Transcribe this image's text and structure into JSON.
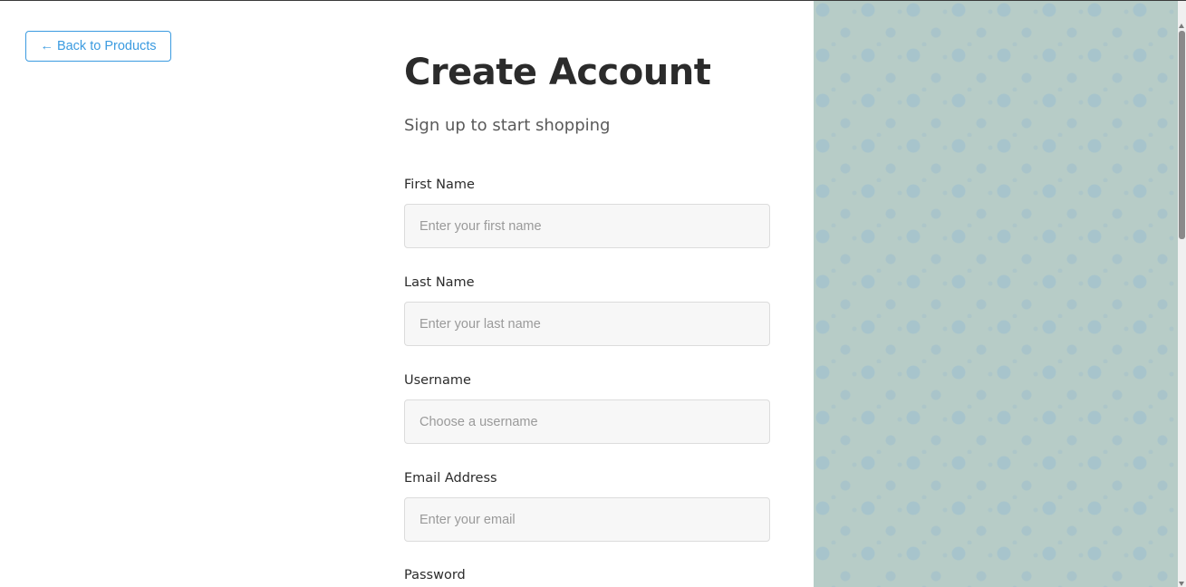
{
  "nav": {
    "back_arrow": "←",
    "back_label": "Back to Products"
  },
  "header": {
    "title": "Create Account",
    "subtitle": "Sign up to start shopping"
  },
  "form": {
    "first_name": {
      "label": "First Name",
      "placeholder": "Enter your first name",
      "value": ""
    },
    "last_name": {
      "label": "Last Name",
      "placeholder": "Enter your last name",
      "value": ""
    },
    "username": {
      "label": "Username",
      "placeholder": "Choose a username",
      "value": ""
    },
    "email": {
      "label": "Email Address",
      "placeholder": "Enter your email",
      "value": ""
    },
    "password": {
      "label": "Password"
    }
  },
  "colors": {
    "accent": "#3b9be0",
    "panel_bg": "#b7ccc7",
    "title_text": "#2b2b2b",
    "input_bg": "#f7f7f7"
  }
}
